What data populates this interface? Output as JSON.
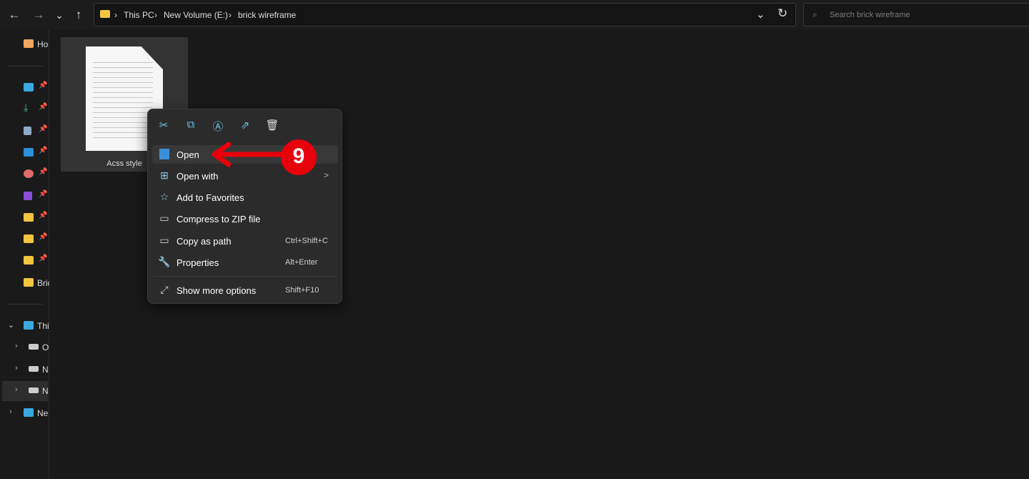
{
  "toolbar": {
    "back": "←",
    "forward": "→",
    "recent": "⌄",
    "up": "↑"
  },
  "address": {
    "crumbs": [
      "This PC",
      "New Volume (E:)",
      "brick wireframe"
    ],
    "separator": "›",
    "dropdown": "⌄",
    "refresh": "↻"
  },
  "search": {
    "placeholder": "Search brick wireframe",
    "icon": "search-icon"
  },
  "sidebar": {
    "home": "Ho",
    "pinned_folder": "Bric",
    "this_pc": "Thi",
    "drives": [
      "O",
      "N",
      "N"
    ],
    "network": "Ne",
    "pin": "📌"
  },
  "file": {
    "name": "Acss style"
  },
  "context_menu": {
    "quick_actions": [
      "cut",
      "copy",
      "rename",
      "share",
      "delete"
    ],
    "items": [
      {
        "label": "Open",
        "shortcut": ""
      },
      {
        "label": "Open with",
        "shortcut": "",
        "submenu": ">"
      },
      {
        "label": "Add to Favorites",
        "shortcut": ""
      },
      {
        "label": "Compress to ZIP file",
        "shortcut": ""
      },
      {
        "label": "Copy as path",
        "shortcut": "Ctrl+Shift+C"
      },
      {
        "label": "Properties",
        "shortcut": "Alt+Enter"
      },
      {
        "label": "Show more options",
        "shortcut": "Shift+F10"
      }
    ]
  },
  "annotation": {
    "step": "9",
    "color": "#e8000b"
  }
}
